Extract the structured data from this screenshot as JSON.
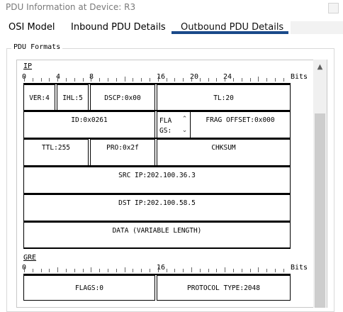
{
  "window": {
    "title": "PDU Information at Device: R3"
  },
  "tabs": [
    {
      "label": "OSI Model"
    },
    {
      "label": "Inbound PDU Details"
    },
    {
      "label": "Outbound PDU Details",
      "selected": true
    }
  ],
  "group": {
    "label": "PDU Formats"
  },
  "ip": {
    "label": "IP",
    "ruler": [
      "0",
      "4",
      "8",
      "16",
      "20",
      "24"
    ],
    "bits_label": "Bits",
    "fields": {
      "ver": "VER:4",
      "ihl": "IHL:5",
      "dscp": "DSCP:0x00",
      "tl": "TL:20",
      "id": "ID:0x0261",
      "flags": "FLA\nGS:",
      "frag_offset": "FRAG OFFSET:0x000",
      "ttl": "TTL:255",
      "pro": "PRO:0x2f",
      "chksum": "CHKSUM",
      "src_ip": "SRC IP:202.100.36.3",
      "dst_ip": "DST IP:202.100.58.5",
      "data": "DATA (VARIABLE LENGTH)"
    }
  },
  "gre": {
    "label": "GRE",
    "ruler": [
      "0",
      "16"
    ],
    "bits_label": "Bits",
    "fields": {
      "flags": "FLAGS:0",
      "protocol_type": "PROTOCOL TYPE:2048"
    }
  },
  "icons": {
    "scroll_up": "triangle-up-icon",
    "flags_scroll_up": "chevron-up-icon",
    "flags_scroll_down": "chevron-down-icon"
  },
  "colors": {
    "tab_underline": "#1a4a8a",
    "title_text": "#7a7a7a"
  }
}
